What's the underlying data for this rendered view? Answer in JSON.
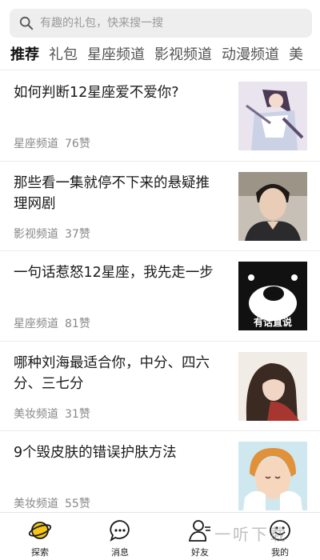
{
  "search": {
    "placeholder": "有趣的礼包，快来搜一搜",
    "icon": "search-icon"
  },
  "tabs": [
    {
      "label": "推荐",
      "active": true
    },
    {
      "label": "礼包"
    },
    {
      "label": "星座频道"
    },
    {
      "label": "影视频道"
    },
    {
      "label": "动漫频道"
    },
    {
      "label": "美"
    }
  ],
  "feed": [
    {
      "title": "如何判断12星座爱不爱你?",
      "channel": "星座频道",
      "likes": "76赞",
      "thumb": "anime-character-image"
    },
    {
      "title": "那些看一集就停不下来的悬疑推理网剧",
      "channel": "影视频道",
      "likes": "37赞",
      "thumb": "actor-portrait-image"
    },
    {
      "title": "一句话惹怒12星座，我先走一步",
      "channel": "星座频道",
      "likes": "81赞",
      "thumb": "bear-mascot-image",
      "thumb_text": "有话直说"
    },
    {
      "title": "哪种刘海最适合你，中分、四六分、三七分",
      "channel": "美妆频道",
      "likes": "31赞",
      "thumb": "woman-portrait-image"
    },
    {
      "title": "9个毁皮肤的错误护肤方法",
      "channel": "美妆频道",
      "likes": "55赞",
      "thumb": "skincare-illustration-image"
    }
  ],
  "tabbar": [
    {
      "label": "探索",
      "icon": "planet-icon",
      "color": "#f5c518"
    },
    {
      "label": "消息",
      "icon": "message-bubble-icon"
    },
    {
      "label": "好友",
      "icon": "friends-icon"
    },
    {
      "label": "我的",
      "icon": "smiley-face-icon"
    }
  ],
  "watermark": "一听下载"
}
